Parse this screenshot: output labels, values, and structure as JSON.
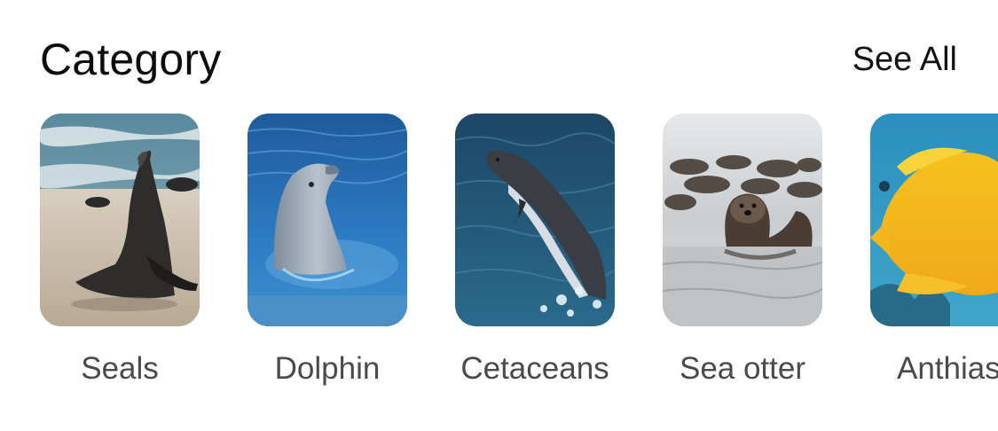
{
  "header": {
    "title": "Category",
    "see_all_label": "See All"
  },
  "categories": [
    {
      "label": "Seals",
      "image": "sea-lion-photo"
    },
    {
      "label": "Dolphin",
      "image": "dolphin-photo"
    },
    {
      "label": "Cetaceans",
      "image": "leaping-dolphin-photo"
    },
    {
      "label": "Sea otter",
      "image": "sea-otter-photo"
    },
    {
      "label": "Anthias",
      "image": "yellow-fish-photo"
    }
  ],
  "colors": {
    "title": "#0c0c0c",
    "label": "#4a4a4a",
    "background": "#ffffff"
  }
}
